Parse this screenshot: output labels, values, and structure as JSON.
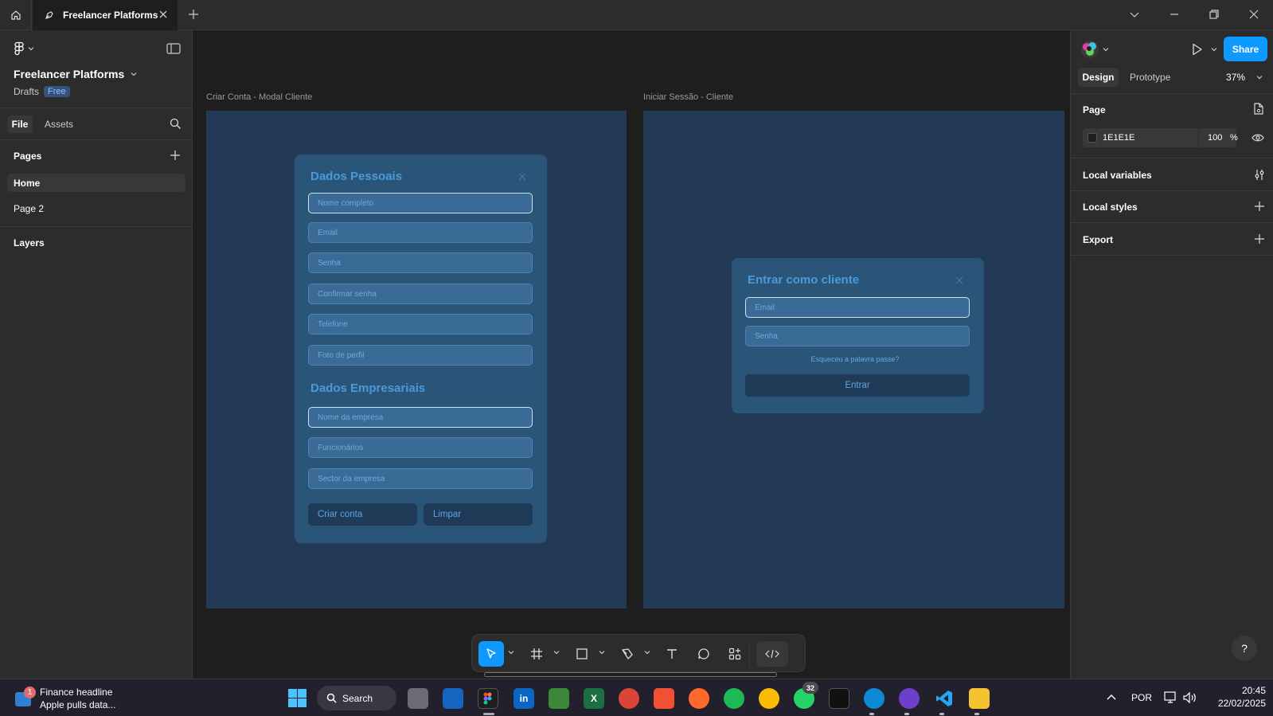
{
  "titlebar": {
    "tab_title": "Freelancer Platforms"
  },
  "left": {
    "file_title": "Freelancer Platforms",
    "drafts": "Drafts",
    "plan_badge": "Free",
    "tab_file": "File",
    "tab_assets": "Assets",
    "pages_heading": "Pages",
    "pages": [
      "Home",
      "Page 2"
    ],
    "layers_heading": "Layers"
  },
  "canvas": {
    "frame1_label": "Criar Conta - Modal Cliente",
    "frame2_label": "Iniciar Sessão - Cliente",
    "signup": {
      "personal_title": "Dados Pessoais",
      "fields_personal": [
        "Nome completo",
        "Email",
        "Senha",
        "Confirmar senha",
        "Telefone",
        "Foto de perfil"
      ],
      "business_title": "Dados Empresariais",
      "fields_business": [
        "Nome da empresa",
        "Funcionários",
        "Sector da empresa"
      ],
      "create_button": "Criar conta",
      "clear_button": "Limpar"
    },
    "login": {
      "title": "Entrar como cliente",
      "email_placeholder": "Email",
      "password_placeholder": "Senha",
      "forgot_link": "Esqueceu a palavra passe?",
      "submit_button": "Entrar"
    }
  },
  "right": {
    "share_button": "Share",
    "tab_design": "Design",
    "tab_prototype": "Prototype",
    "zoom": "37%",
    "page_heading": "Page",
    "page_color": "1E1E1E",
    "page_opacity": "100",
    "opacity_unit": "%",
    "local_variables": "Local variables",
    "local_styles": "Local styles",
    "export": "Export",
    "help": "?"
  },
  "taskbar": {
    "news_title": "Finance headline",
    "news_sub": "Apple pulls data...",
    "news_badge": "1",
    "search_label": "Search",
    "whatsapp_badge": "32",
    "lang": "POR",
    "time": "20:45",
    "date": "22/02/2025"
  },
  "colors": {
    "figma_blue": "#0d99ff",
    "frame_bg": "#223a55",
    "modal_bg": "#2b5479",
    "accent_text": "#4a9ad9"
  }
}
